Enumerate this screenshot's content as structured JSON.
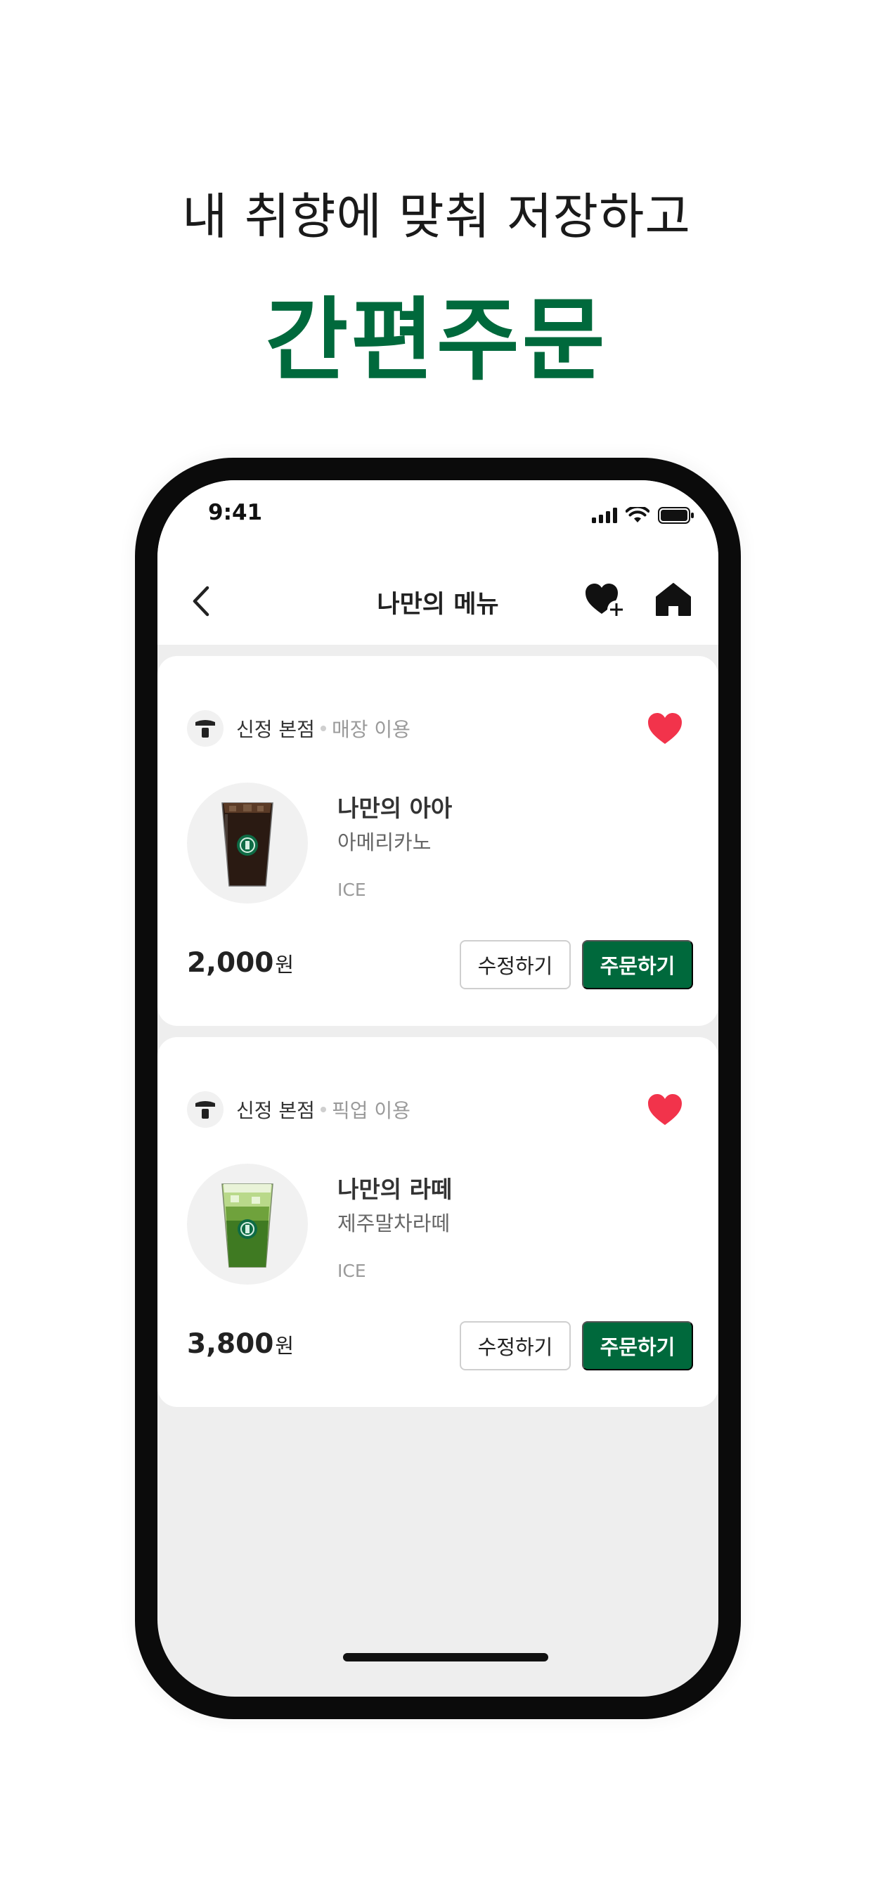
{
  "promo": {
    "subtitle": "내 취향에 맞춰 저장하고",
    "title": "간편주문"
  },
  "status_bar": {
    "time": "9:41"
  },
  "nav": {
    "title": "나만의 메뉴",
    "icons": [
      "back-chevron-icon",
      "heart-plus-icon",
      "home-icon"
    ]
  },
  "menu_items": [
    {
      "store": "신정 본점",
      "service": "매장 이용",
      "name": "나만의 아아",
      "base_drink": "아메리카노",
      "temperature": "ICE",
      "price": "2,000",
      "currency": "원",
      "edit_label": "수정하기",
      "order_label": "주문하기",
      "favorited": true
    },
    {
      "store": "신정 본점",
      "service": "픽업 이용",
      "name": "나만의 라떼",
      "base_drink": "제주말차라떼",
      "temperature": "ICE",
      "price": "3,800",
      "currency": "원",
      "edit_label": "수정하기",
      "order_label": "주문하기",
      "favorited": true
    }
  ],
  "colors": {
    "brand_green": "#00693c",
    "heart_red": "#f2334b",
    "screen_bg": "#eeeeee"
  }
}
